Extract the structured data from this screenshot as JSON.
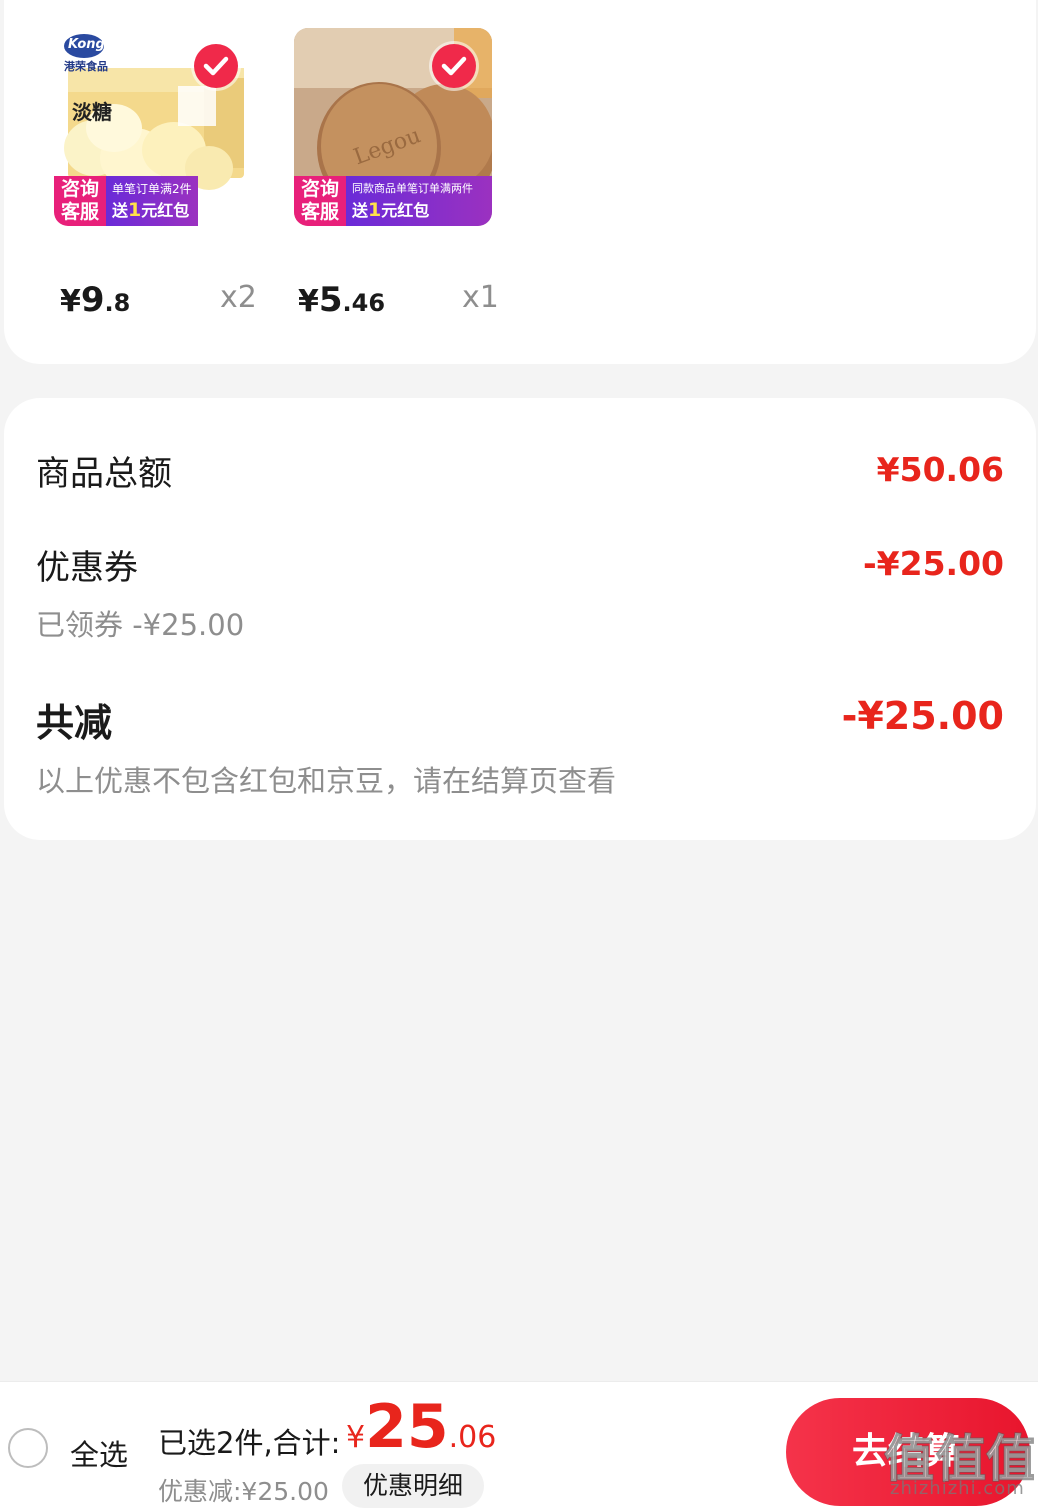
{
  "products": [
    {
      "brand": "Kong",
      "brand_sub": "港荣食品",
      "box_text": "淡糖",
      "promo_left": "咨询客服",
      "promo_line1": "单笔订单满2件",
      "promo_line2_prefix": "送",
      "promo_line2_amount": "1",
      "promo_line2_suffix": "元红包",
      "price_yen": "¥",
      "price_int": "9",
      "price_dec": ".8",
      "qty": "x2",
      "selected": true
    },
    {
      "promo_left": "咨询客服",
      "promo_line1": "同款商品单笔订单满两件",
      "promo_line2_prefix": "送",
      "promo_line2_amount": "1",
      "promo_line2_suffix": "元红包",
      "price_yen": "¥",
      "price_int": "5",
      "price_dec": ".46",
      "qty": "x1",
      "selected": true
    }
  ],
  "summary": {
    "goods_total_label": "商品总额",
    "goods_total_value": "¥50.06",
    "coupon_label": "优惠券",
    "coupon_value": "-¥25.00",
    "coupon_sub": "已领券 -¥25.00",
    "total_discount_label": "共减",
    "total_discount_value": "-¥25.00",
    "note": "以上优惠不包含红包和京豆，请在结算页查看"
  },
  "bottom_bar": {
    "select_all_label": "全选",
    "selected_count_text": "已选2件,合计:",
    "total_yen": "¥",
    "total_int": "25",
    "total_dec": ".06",
    "discount_text": "优惠减:¥25.00",
    "detail_button": "优惠明细",
    "checkout_button": "去结算"
  },
  "watermark": {
    "text": "zhizhizhi.com",
    "glyph": "值"
  },
  "colors": {
    "accent_red": "#e8251c",
    "check_red": "#f0294a",
    "background": "#f4f4f4"
  }
}
